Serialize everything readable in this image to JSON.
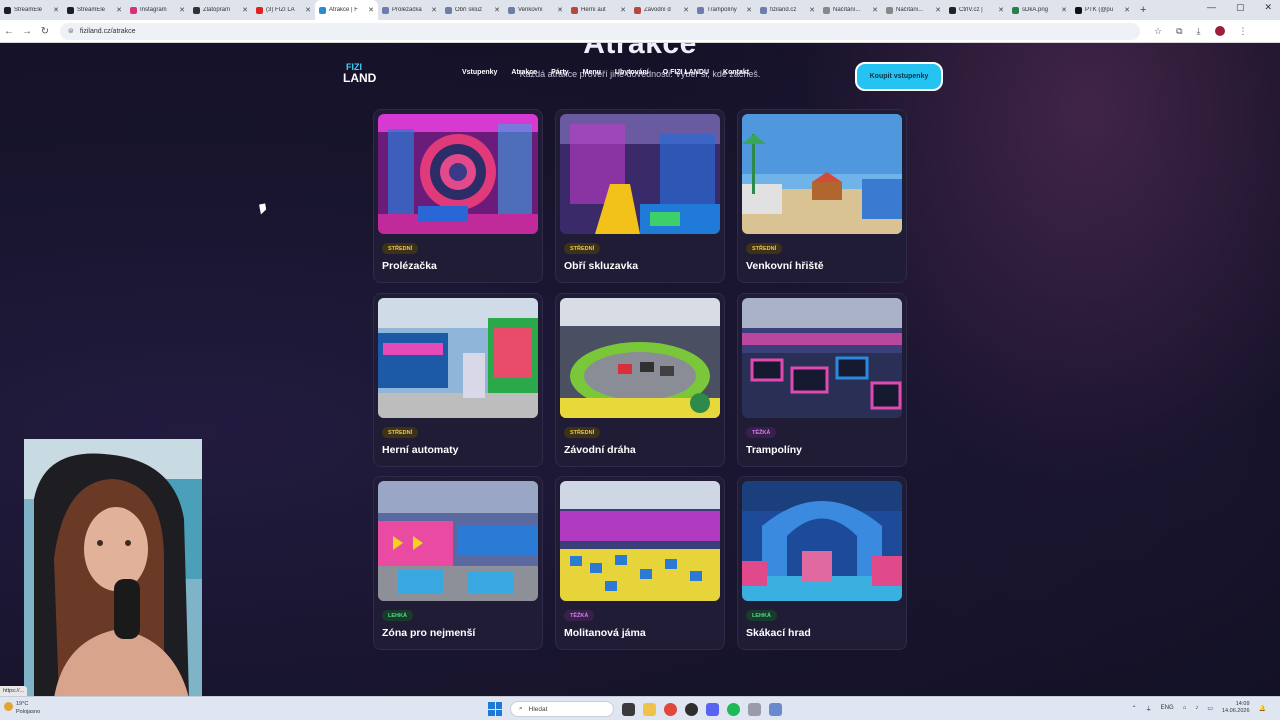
{
  "browser": {
    "tabs": [
      {
        "title": "StreamEle",
        "color": "#1b1b2b",
        "active": false
      },
      {
        "title": "StreamEle",
        "color": "#1b1b2b",
        "active": false
      },
      {
        "title": "Instagram",
        "color": "#d6307b",
        "active": false
      },
      {
        "title": "Zlatopram",
        "color": "#333333",
        "active": false
      },
      {
        "title": "(3) FIZI LA",
        "color": "#e02020",
        "active": false
      },
      {
        "title": "Atrakce | F",
        "color": "#2a8bd4",
        "active": true
      },
      {
        "title": "Prolézačka",
        "color": "#6b7da8",
        "active": false
      },
      {
        "title": "Obří skluz",
        "color": "#6b7da8",
        "active": false
      },
      {
        "title": "Venkovní",
        "color": "#6b7da8",
        "active": false
      },
      {
        "title": "Herní aut",
        "color": "#b8473d",
        "active": false
      },
      {
        "title": "Závodní d",
        "color": "#b8473d",
        "active": false
      },
      {
        "title": "Trampolíny",
        "color": "#6b7da8",
        "active": false
      },
      {
        "title": "fiziland.cz",
        "color": "#6b7da8",
        "active": false
      },
      {
        "title": "Načítání...",
        "color": "#888888",
        "active": false
      },
      {
        "title": "Načítání...",
        "color": "#888888",
        "active": false
      },
      {
        "title": "CtrlV.cz |",
        "color": "#222222",
        "active": false
      },
      {
        "title": "sDkA.png",
        "color": "#2e7d4f",
        "active": false
      },
      {
        "title": "PTK (@pu",
        "color": "#111111",
        "active": false
      }
    ],
    "url": "fiziland.cz/atrakce"
  },
  "site": {
    "title": "Atrakce",
    "subtitle": "Každá atrakce prověří jiné dovednosti. Vyber si, kde začneš.",
    "logo_top": "FIZI",
    "logo_bottom": "LAND",
    "nav": [
      "Vstupenky",
      "Atrakce",
      "Párty",
      "Menu",
      "Ubytování",
      "O FIZI LANDU",
      "Kontakt"
    ],
    "cta": "Koupit vstupenky"
  },
  "attractions": [
    {
      "name": "Prolézačka",
      "difficulty": "STŘEDNÍ",
      "level": "stredni"
    },
    {
      "name": "Obří skluzavka",
      "difficulty": "STŘEDNÍ",
      "level": "stredni"
    },
    {
      "name": "Venkovní hřiště",
      "difficulty": "STŘEDNÍ",
      "level": "stredni"
    },
    {
      "name": "Herní automaty",
      "difficulty": "STŘEDNÍ",
      "level": "stredni"
    },
    {
      "name": "Závodní dráha",
      "difficulty": "STŘEDNÍ",
      "level": "stredni"
    },
    {
      "name": "Trampolíny",
      "difficulty": "TĚŽKÁ",
      "level": "tezka"
    },
    {
      "name": "Zóna pro nejmenší",
      "difficulty": "LEHKÁ",
      "level": "lehka"
    },
    {
      "name": "Molitanová jáma",
      "difficulty": "TĚŽKÁ",
      "level": "tezka"
    },
    {
      "name": "Skákací hrad",
      "difficulty": "LEHKÁ",
      "level": "lehka"
    }
  ],
  "status_url": "https://...",
  "taskbar": {
    "weather_temp": "19°C",
    "weather_text": "Polojasno",
    "search_placeholder": "Hledat",
    "language": "ENG",
    "time": "14:09",
    "date": "14.06.2026"
  }
}
